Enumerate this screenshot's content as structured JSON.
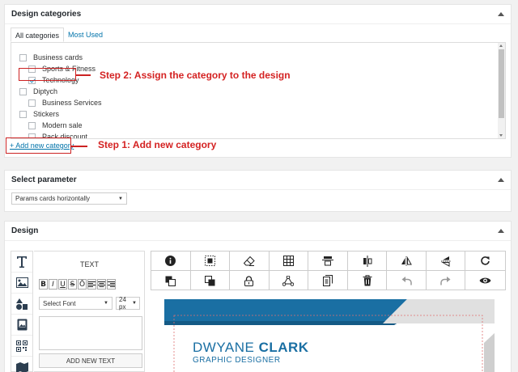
{
  "categories_panel": {
    "title": "Design categories",
    "tabs": [
      "All categories",
      "Most Used"
    ],
    "items": [
      {
        "label": "Business cards",
        "checked": false,
        "level": 0
      },
      {
        "label": "Sports & Fitness",
        "checked": false,
        "level": 1
      },
      {
        "label": "Technology",
        "checked": true,
        "level": 1
      },
      {
        "label": "Diptych",
        "checked": false,
        "level": 0
      },
      {
        "label": "Business Services",
        "checked": false,
        "level": 1
      },
      {
        "label": "Stickers",
        "checked": false,
        "level": 0
      },
      {
        "label": "Modern sale",
        "checked": false,
        "level": 1
      },
      {
        "label": "Pack discount",
        "checked": false,
        "level": 1
      }
    ],
    "add_link": "+ Add new category"
  },
  "annotations": {
    "step2": "Step 2: Assign the category to the design",
    "step1": "Step 1: Add new category",
    "color": "#d42222"
  },
  "param_panel": {
    "title": "Select parameter",
    "select_value": "Params cards horizontally"
  },
  "design_panel": {
    "title": "Design",
    "text_heading": "TEXT",
    "format_buttons": [
      "B",
      "I",
      "U",
      "S",
      "Ō",
      "align-left",
      "align-center",
      "align-right"
    ],
    "font_select": "Select Font",
    "size_select": "24 px",
    "add_text_button": "ADD NEW TEXT",
    "left_tools": [
      "text-tool-icon",
      "image-tool-icon",
      "shapes-tool-icon",
      "clipart-tool-icon",
      "qrcode-tool-icon",
      "map-tool-icon"
    ],
    "toolbar_icons": [
      "info-icon",
      "select-all-icon",
      "eraser-icon",
      "grid-icon",
      "align-center-horizontal-icon",
      "align-center-vertical-icon",
      "flip-horizontal-icon",
      "flip-vertical-icon",
      "reset-icon",
      "send-backward-icon",
      "bring-forward-icon",
      "lock-icon",
      "group-icon",
      "copy-icon",
      "delete-icon",
      "undo-icon",
      "redo-icon",
      "preview-icon"
    ]
  },
  "card": {
    "first_name": "DWYANE",
    "last_name": "CLARK",
    "job_title": "GRAPHIC DESIGNER",
    "primary_color": "#1a6fa3"
  }
}
